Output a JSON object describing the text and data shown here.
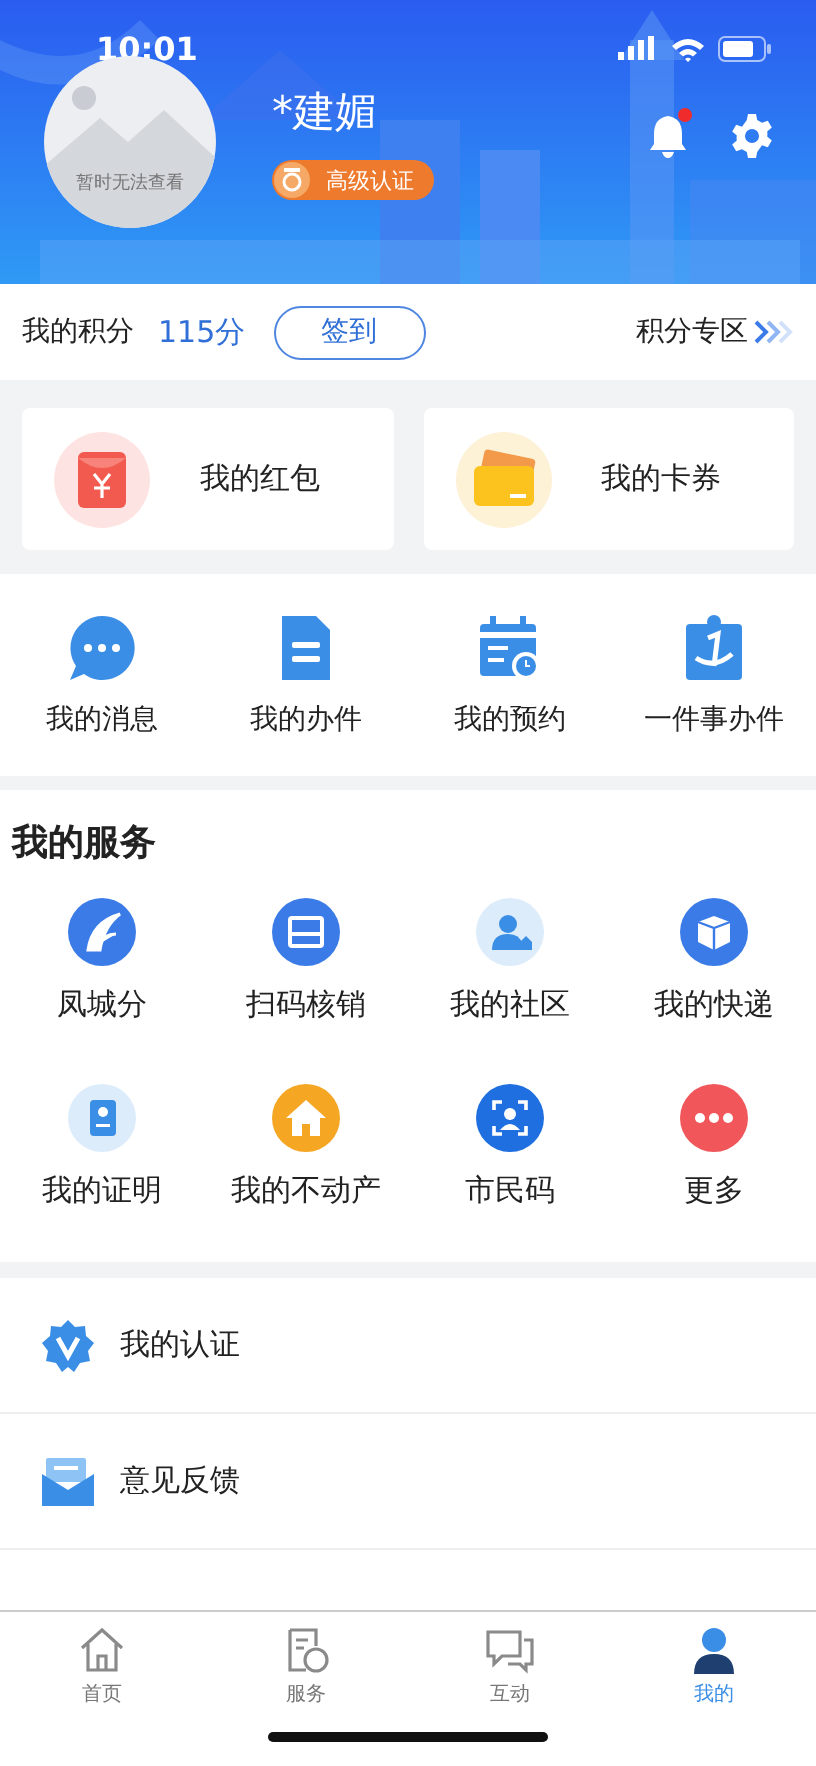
{
  "status_bar": {
    "time": "10:01"
  },
  "profile": {
    "avatar_text": "暂时无法查看",
    "name": "*建媚",
    "badge": "高级认证",
    "notification_unread": true
  },
  "points": {
    "label": "我的积分",
    "value": "115分",
    "checkin_button": "签到",
    "zone_link": "积分专区"
  },
  "wallet": [
    {
      "kind": "red-packet",
      "label": "我的红包"
    },
    {
      "kind": "card",
      "label": "我的卡券"
    }
  ],
  "quick_actions": [
    {
      "kind": "message",
      "label": "我的消息"
    },
    {
      "kind": "document",
      "label": "我的办件"
    },
    {
      "kind": "calendar",
      "label": "我的预约"
    },
    {
      "kind": "clipboard",
      "label": "一件事办件"
    }
  ],
  "services": {
    "title": "我的服务",
    "items": [
      {
        "kind": "wing",
        "label": "凤城分"
      },
      {
        "kind": "scan",
        "label": "扫码核销"
      },
      {
        "kind": "person",
        "label": "我的社区"
      },
      {
        "kind": "box",
        "label": "我的快递"
      },
      {
        "kind": "id",
        "label": "我的证明"
      },
      {
        "kind": "house",
        "label": "我的不动产"
      },
      {
        "kind": "face",
        "label": "市民码"
      },
      {
        "kind": "more",
        "label": "更多"
      }
    ]
  },
  "list": [
    {
      "kind": "verify",
      "label": "我的认证"
    },
    {
      "kind": "feedback",
      "label": "意见反馈"
    }
  ],
  "tab_bar": [
    {
      "kind": "home",
      "label": "首页",
      "selected": false
    },
    {
      "kind": "service",
      "label": "服务",
      "selected": false
    },
    {
      "kind": "chat",
      "label": "互动",
      "selected": false
    },
    {
      "kind": "me",
      "label": "我的",
      "selected": true
    }
  ]
}
